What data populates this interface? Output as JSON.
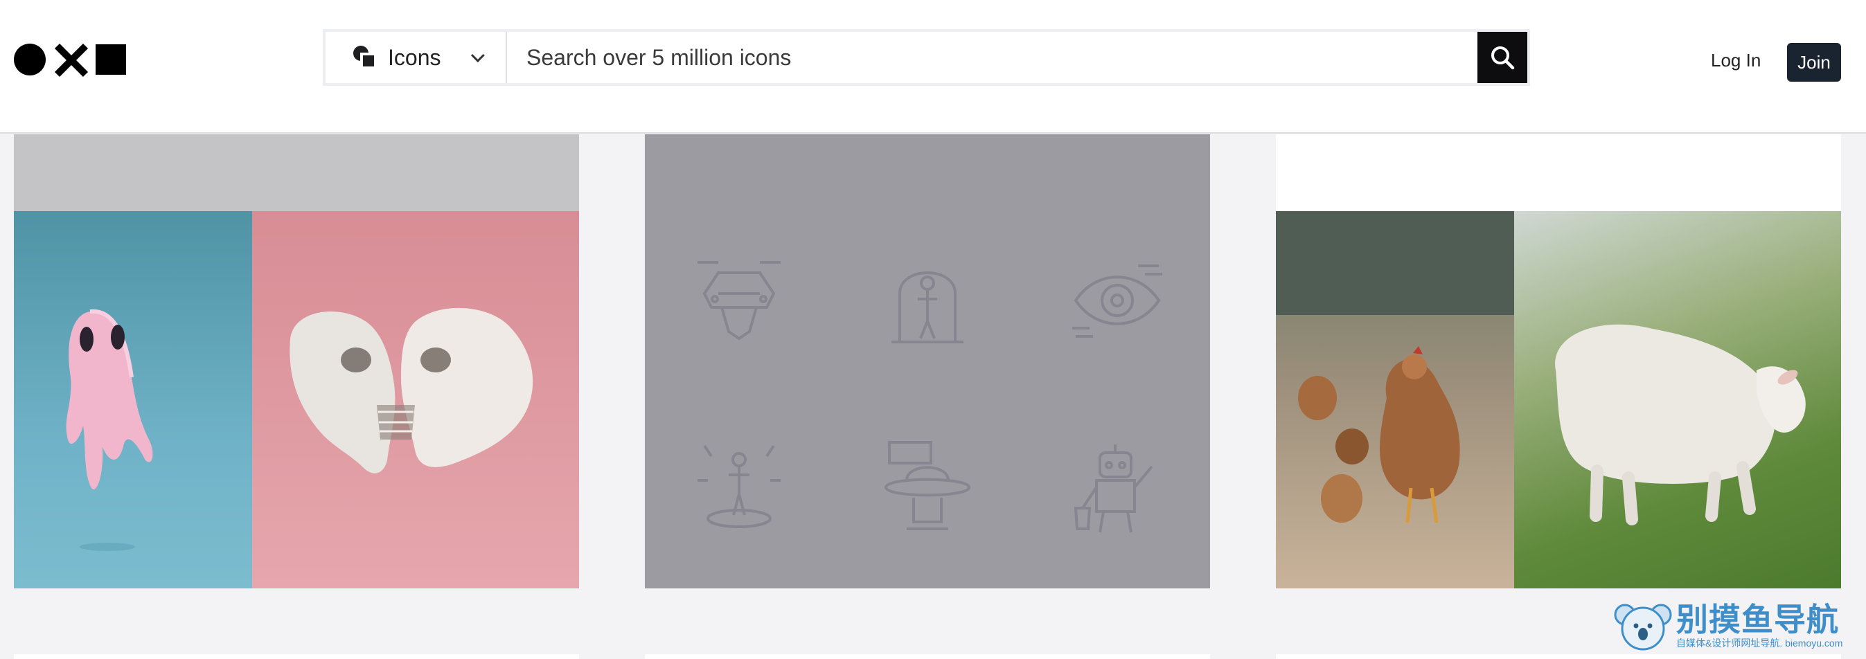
{
  "header": {
    "logo_icon": "circle-x-square-logo",
    "search": {
      "type_label": "Icons",
      "type_icon": "icons-shapes-icon",
      "placeholder": "Search over 5 million icons",
      "value": "",
      "button_icon": "search-icon"
    },
    "login_label": "Log In",
    "join_label": "Join"
  },
  "cards": [
    {
      "name": "ghost-and-skulls-collection",
      "colors": [
        "#c4c4c7",
        "#6fb2c7",
        "#e6a6ad"
      ]
    },
    {
      "name": "sci-fi-icon-collection",
      "icons": [
        "flying-car-icon",
        "human-capsule-icon",
        "eye-gear-icon",
        "hologram-person-icon",
        "ufo-icon",
        "robot-icon"
      ],
      "colors": [
        "#9c9ba1",
        "#87868c"
      ]
    },
    {
      "name": "chickens-and-lamb-collection",
      "colors": [
        "#ffffff",
        "#9c8f7b",
        "#5f8a3b"
      ]
    }
  ],
  "watermark": {
    "title": "别摸鱼导航",
    "subtitle": "自媒体&设计师网址导航.",
    "domain": "biemoyu.com"
  }
}
